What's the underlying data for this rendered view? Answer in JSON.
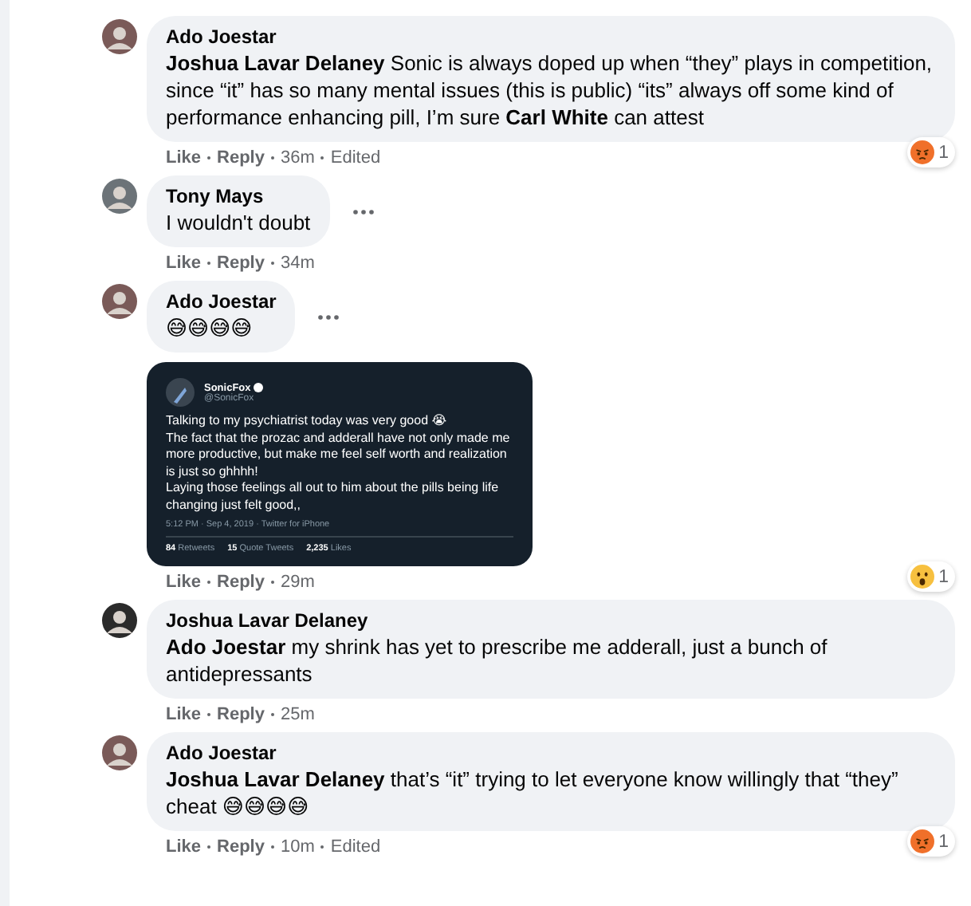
{
  "comments": [
    {
      "author": "Ado Joestar",
      "body": "**Joshua Lavar Delaney** Sonic is always doped up when “they” plays in competition, since “it” has so many mental issues (this is public) “its” always off some kind of performance enhancing pill, I’m sure **Carl White** can attest",
      "menu_shown": false,
      "actions": {
        "like": "Like",
        "reply": "Reply",
        "time": "36m",
        "edited": "Edited"
      },
      "reaction": {
        "kind": "angry",
        "count": "1"
      }
    },
    {
      "author": "Tony Mays",
      "body": "I wouldn't doubt",
      "menu_shown": true,
      "actions": {
        "like": "Like",
        "reply": "Reply",
        "time": "34m"
      }
    },
    {
      "author": "Ado Joestar",
      "body": "😅😅😅😅",
      "menu_shown": true,
      "attachment": {
        "name": "SonicFox",
        "handle": "@SonicFox",
        "verified": true,
        "text": "Talking to my psychiatrist today was very good 😭\nThe fact that the prozac and adderall have not only made me more productive, but make me feel self worth and realization is just so ghhhh!\nLaying those feelings all out to him about the pills being life changing just felt good,,",
        "meta": "5:12 PM · Sep 4, 2019 · Twitter for iPhone",
        "stats": [
          {
            "count": "84",
            "label": "Retweets"
          },
          {
            "count": "15",
            "label": "Quote Tweets"
          },
          {
            "count": "2,235",
            "label": "Likes"
          }
        ]
      },
      "actions": {
        "like": "Like",
        "reply": "Reply",
        "time": "29m"
      },
      "reaction": {
        "kind": "wow",
        "count": "1"
      }
    },
    {
      "author": "Joshua Lavar Delaney",
      "body": "**Ado Joestar** my shrink has yet to prescribe me adderall, just a bunch of antidepressants",
      "menu_shown": false,
      "actions": {
        "like": "Like",
        "reply": "Reply",
        "time": "25m"
      }
    },
    {
      "author": "Ado Joestar",
      "body": "**Joshua Lavar Delaney** that’s “it” trying to let everyone know willingly that “they” cheat 😅😅😅😅",
      "menu_shown": false,
      "actions": {
        "like": "Like",
        "reply": "Reply",
        "time": "10m",
        "edited": "Edited"
      },
      "reaction": {
        "kind": "angry",
        "count": "1"
      }
    }
  ]
}
